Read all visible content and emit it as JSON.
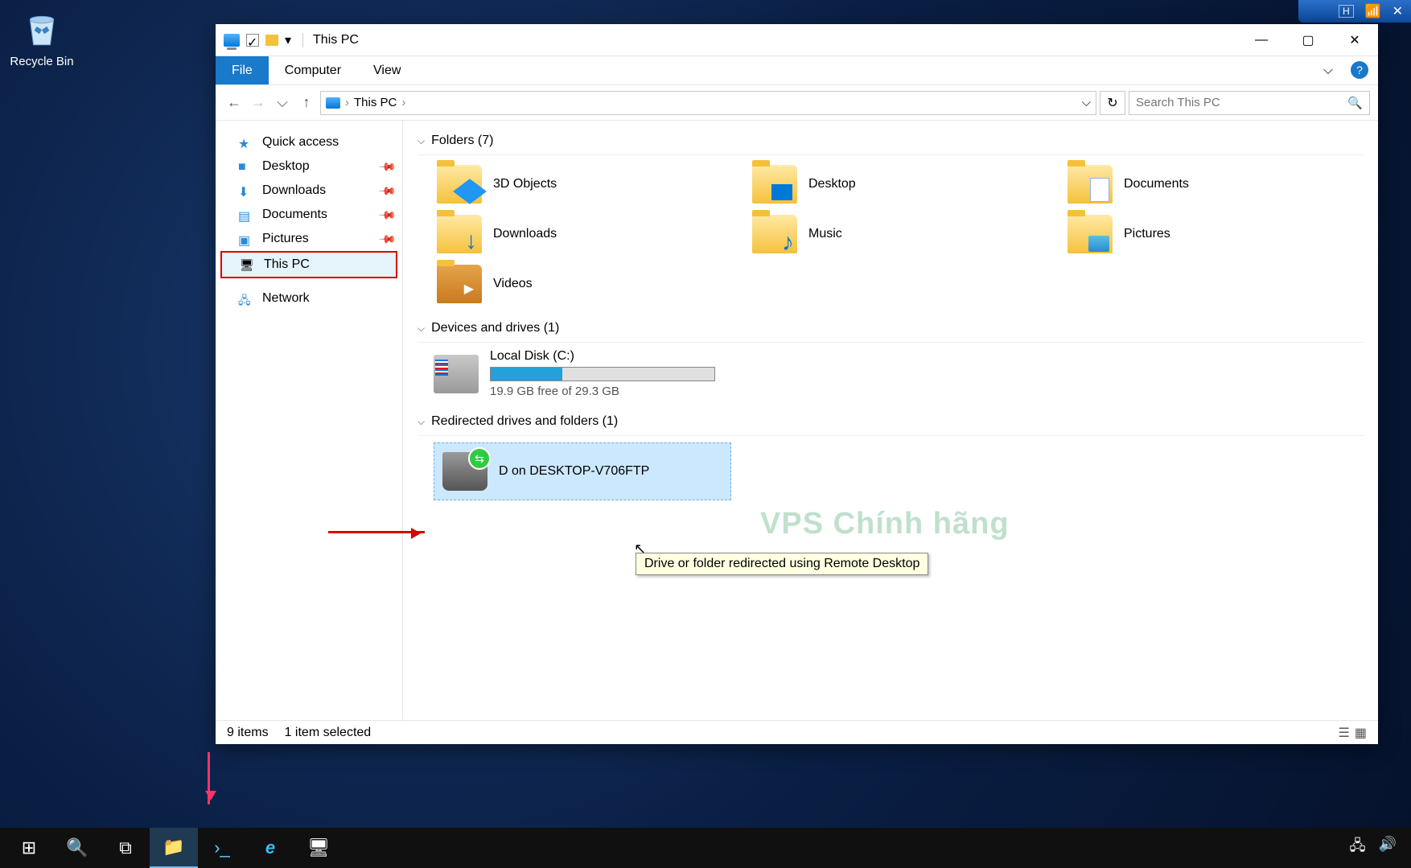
{
  "rdp_bar": {
    "pin_icon": "H",
    "signal_icon": "📶",
    "close_icon": "✕"
  },
  "desktop": {
    "recycle_bin": "Recycle Bin"
  },
  "window": {
    "title": "This PC",
    "controls": {
      "min": "—",
      "max": "▢",
      "close": "✕"
    },
    "qat_dropdown": "▾"
  },
  "ribbon": {
    "file": "File",
    "computer": "Computer",
    "view": "View",
    "help": "?",
    "expand": "⌵"
  },
  "nav": {
    "back": "←",
    "forward": "→",
    "recent": "⌵",
    "up": "↑",
    "path_root": "This PC",
    "chevron": "›",
    "addr_dropdown": "⌵",
    "refresh": "↻",
    "search_placeholder": "Search This PC",
    "mag": "🔍"
  },
  "sidebar": {
    "items": [
      {
        "label": "Quick access",
        "icon": "ic-star",
        "pinned": false
      },
      {
        "label": "Desktop",
        "icon": "ic-desk",
        "pinned": true
      },
      {
        "label": "Downloads",
        "icon": "ic-down",
        "pinned": true
      },
      {
        "label": "Documents",
        "icon": "ic-docs",
        "pinned": true
      },
      {
        "label": "Pictures",
        "icon": "ic-pics",
        "pinned": true
      },
      {
        "label": "This PC",
        "icon": "ic-pc",
        "pinned": false,
        "selected": true
      },
      {
        "label": "Network",
        "icon": "ic-net",
        "pinned": false
      }
    ]
  },
  "groups": {
    "folders": {
      "title": "Folders (7)",
      "items": [
        {
          "label": "3D Objects",
          "cls": "fic-3d"
        },
        {
          "label": "Desktop",
          "cls": "fic-desk"
        },
        {
          "label": "Documents",
          "cls": "fic-docs"
        },
        {
          "label": "Downloads",
          "cls": "fic-down"
        },
        {
          "label": "Music",
          "cls": "fic-music"
        },
        {
          "label": "Pictures",
          "cls": "fic-pics"
        },
        {
          "label": "Videos",
          "cls": "fic-vid"
        }
      ]
    },
    "drives": {
      "title": "Devices and drives (1)",
      "items": [
        {
          "label": "Local Disk (C:)",
          "free": "19.9 GB free of 29.3 GB",
          "fill_pct": 32
        }
      ]
    },
    "redirected": {
      "title": "Redirected drives and folders (1)",
      "items": [
        {
          "label": "D on DESKTOP-V706FTP"
        }
      ]
    }
  },
  "tooltip": "Drive or folder redirected using Remote Desktop",
  "watermark": "VPS Chính hãng",
  "statusbar": {
    "count": "9 items",
    "selected": "1 item selected"
  },
  "taskbar": {
    "start": "⊞",
    "search": "🔍",
    "taskview": "⧉",
    "explorer": "📁",
    "powershell": "›_",
    "ie": "e",
    "rdp": "🖥",
    "tray_net": "🖧",
    "tray_vol": "🔊"
  }
}
